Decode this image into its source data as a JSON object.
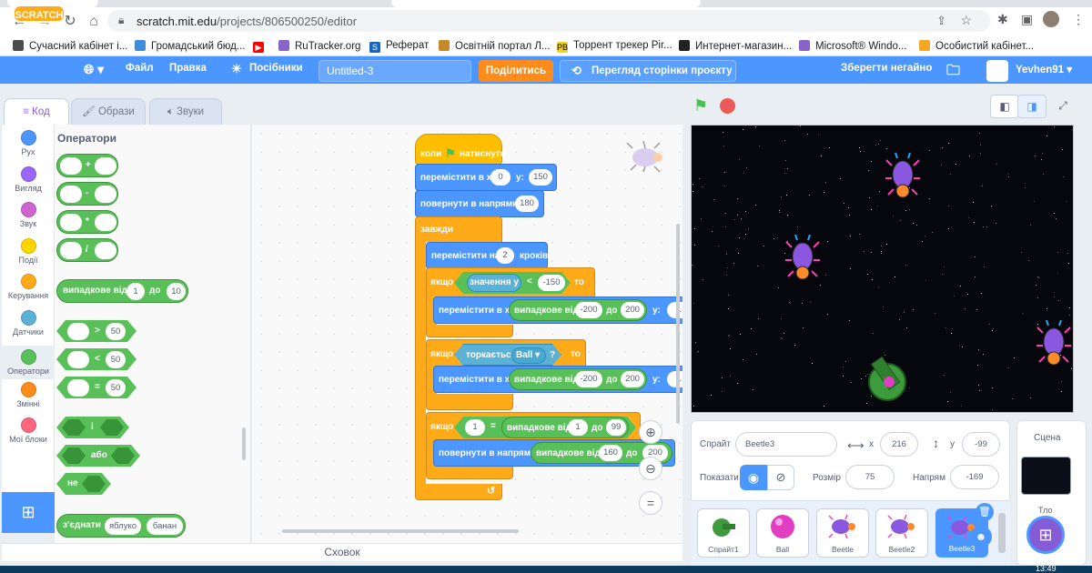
{
  "browser": {
    "url_domain": "scratch.mit.edu",
    "url_path": "/projects/806500250/editor",
    "bookmarks": [
      {
        "label": "Сучасний кабінет і...",
        "color": "#4c4c4c"
      },
      {
        "label": "Громадський бюд...",
        "color": "#3f8dd9"
      },
      {
        "label": "",
        "color": "#ff0000"
      },
      {
        "label": "RuTracker.org",
        "color": "#8a63c9"
      },
      {
        "label": "Реферат",
        "color": "#1565c0"
      },
      {
        "label": "Освітній портал Л...",
        "color": "#c58a2c"
      },
      {
        "label": "Торрент трекер Pir...",
        "color": "#f2d21a"
      },
      {
        "label": "Интернет-магазин...",
        "color": "#222222"
      },
      {
        "label": "Microsoft® Windo...",
        "color": "#8a63c9"
      },
      {
        "label": "Особистий кабінет...",
        "color": "#f5a623"
      }
    ]
  },
  "menu": {
    "logo": "SCRATCH",
    "file": "Файл",
    "edit": "Правка",
    "tutorials": "Посібники",
    "project_title": "Untitled-3",
    "share": "Поділитись",
    "project_page": "Перегляд сторінки проєкту",
    "save_now": "Зберегти негайно",
    "username": "Yevhen91"
  },
  "tabs": {
    "code": "Код",
    "costumes": "Образи",
    "sounds": "Звуки"
  },
  "categories": [
    {
      "label": "Рух",
      "color": "#4c97ff"
    },
    {
      "label": "Вигляд",
      "color": "#9966ff"
    },
    {
      "label": "Звук",
      "color": "#cf63cf"
    },
    {
      "label": "Події",
      "color": "#ffd500"
    },
    {
      "label": "Керування",
      "color": "#ffab19"
    },
    {
      "label": "Датчики",
      "color": "#5cb1d6"
    },
    {
      "label": "Оператори",
      "color": "#59c059"
    },
    {
      "label": "Змінні",
      "color": "#ff8c1a"
    },
    {
      "label": "Мої блоки",
      "color": "#ff6680"
    }
  ],
  "palette": {
    "title": "Оператори",
    "ops": [
      "+",
      "-",
      "*",
      "/"
    ],
    "random": {
      "label": "випадкове від",
      "from": "1",
      "to_label": "до",
      "to": "10"
    },
    "compare": [
      {
        "op": ">",
        "val": "50"
      },
      {
        "op": "<",
        "val": "50"
      },
      {
        "op": "=",
        "val": "50"
      }
    ],
    "and_label": "і",
    "or_label": "або",
    "not_label": "не",
    "join": {
      "label": "з'єднати",
      "a": "яблуко",
      "b": "банан"
    }
  },
  "script": {
    "hat": {
      "label": "коли",
      "suffix": "натиснуто"
    },
    "goto": {
      "label": "перемістити в x:",
      "x": "0",
      "ylabel": "y:",
      "y": "150"
    },
    "point": {
      "label": "повернути в напрямку",
      "value": "180"
    },
    "forever": "завжди",
    "move": {
      "label": "перемістити на",
      "steps": "2",
      "suffix": "кроків"
    },
    "if1": {
      "label": "якщо",
      "reporter": "значення у",
      "op": "<",
      "value": "-150",
      "then": "то"
    },
    "goto_rand1": {
      "label": "перемістити в x:",
      "rnd": "випадкове від",
      "from": "-200",
      "to_label": "до",
      "to": "200",
      "ylabel": "y:",
      "y": "1"
    },
    "if2": {
      "label": "якщо",
      "sensing": "торкається",
      "target": "Ball",
      "q": "?",
      "then": "то"
    },
    "goto_rand2": {
      "label": "перемістити в x:",
      "rnd": "випадкове від",
      "from": "-200",
      "to_label": "до",
      "to": "200",
      "ylabel": "y:",
      "y": "1"
    },
    "if3": {
      "label": "якщо",
      "left": "1",
      "op": "=",
      "rnd": "випадкове від",
      "from": "1",
      "to_label": "до",
      "to": "99"
    },
    "point_rand": {
      "label": "повернути в напрямку",
      "rnd": "випадкове від",
      "from": "160",
      "to_label": "до",
      "to": "200"
    }
  },
  "backpack": "Сховок",
  "sprite_info": {
    "sprite_label": "Спрайт",
    "sprite_name": "Beetle3",
    "x_label": "x",
    "x": "216",
    "y_label": "y",
    "y": "-99",
    "show_label": "Показати",
    "size_label": "Розмір",
    "size": "75",
    "direction_label": "Напрям",
    "direction": "-169"
  },
  "sprites": [
    "Спрайт1",
    "Ball",
    "Beetle",
    "Beetle2",
    "Beetle3"
  ],
  "stage_pane": {
    "title": "Сцена",
    "backdrop_label": "Тло"
  },
  "colors": {
    "scratch_blue": "#4c97ff",
    "operators_green": "#59c059",
    "control_orange": "#ffab19"
  }
}
